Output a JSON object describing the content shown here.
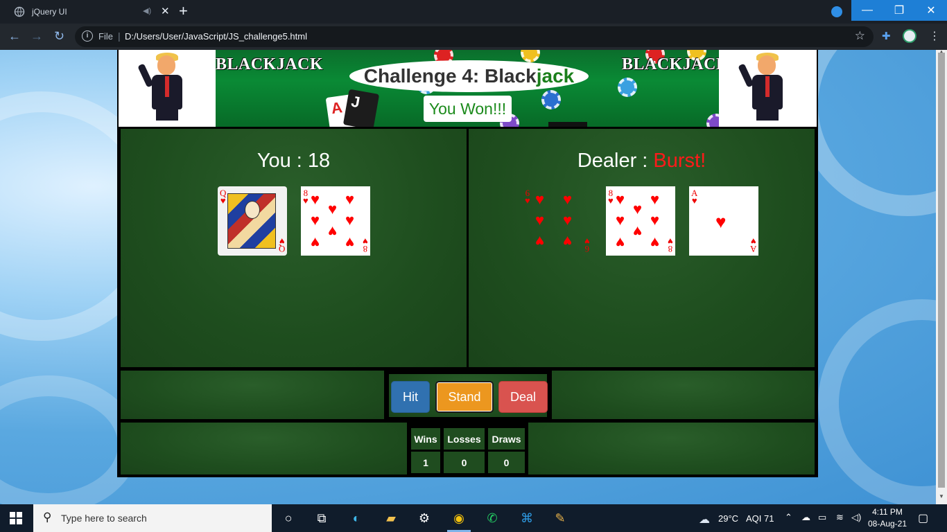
{
  "browser": {
    "tab_title": "jQuery UI",
    "tab_close": "✕",
    "new_tab": "+",
    "address_scheme": "File",
    "address_url": "D:/Users/User/JavaScript/JS_challenge5.html"
  },
  "window_controls": {
    "minimize": "—",
    "maximize": "❐",
    "close": "✕"
  },
  "banner": {
    "title_main": "Challenge 4: Black",
    "title_accent": "jack",
    "result": "You Won!!!",
    "logo_left": "BLACKJACK",
    "logo_right": "BLACKJACK"
  },
  "player": {
    "label": "You : ",
    "score": "18",
    "cards": [
      {
        "rank": "Q",
        "suit": "heart",
        "face": "queen"
      },
      {
        "rank": "8",
        "suit": "heart",
        "face": "pips"
      }
    ]
  },
  "dealer": {
    "label": "Dealer : ",
    "score": "Burst!",
    "cards": [
      {
        "rank": "6",
        "suit": "heart",
        "face": "pips"
      },
      {
        "rank": "8",
        "suit": "heart",
        "face": "pips"
      },
      {
        "rank": "A",
        "suit": "heart",
        "face": "ace"
      }
    ]
  },
  "buttons": {
    "hit": "Hit",
    "stand": "Stand",
    "deal": "Deal"
  },
  "stats": {
    "headers": [
      "Wins",
      "Losses",
      "Draws"
    ],
    "values": [
      "1",
      "0",
      "0"
    ]
  },
  "taskbar": {
    "search_placeholder": "Type here to search",
    "weather": "29°C",
    "aqi": "AQI 71",
    "time": "4:11 PM",
    "date": "08-Aug-21"
  },
  "colors": {
    "felt": "#1e4d1e",
    "hit": "#3071b0",
    "stand": "#ec971f",
    "deal": "#d9534f",
    "burst": "#ff1a1a",
    "won": "#1b8a1b"
  },
  "icons": {
    "back": "arrow-left-icon",
    "forward": "arrow-right-icon",
    "reload": "reload-icon",
    "star": "star-icon",
    "extensions": "puzzle-icon",
    "menu": "kebab-menu-icon"
  }
}
